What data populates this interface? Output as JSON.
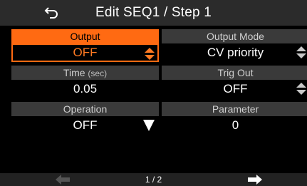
{
  "header": {
    "back_icon": "back-arrow-icon",
    "title": "Edit SEQ1 / Step 1"
  },
  "params": {
    "output": {
      "label": "Output",
      "value": "OFF",
      "control": "updown-icon",
      "selected": true
    },
    "output_mode": {
      "label": "Output Mode",
      "value": "CV priority",
      "control": "updown-icon"
    },
    "time": {
      "label": "Time",
      "unit": "(sec)",
      "value": "0.05"
    },
    "trig_out": {
      "label": "Trig Out",
      "value": "OFF",
      "control": "updown-icon"
    },
    "operation": {
      "label": "Operation",
      "value": "OFF",
      "control": "dropdown-arrow-icon"
    },
    "parameter": {
      "label": "Parameter",
      "value": "0"
    }
  },
  "footer": {
    "prev_icon": "left-arrow-icon",
    "page": "1 / 2",
    "next_icon": "right-arrow-icon"
  },
  "colors": {
    "accent": "#ff6a12",
    "header_bg": "#2b2b2b",
    "label_bg": "#3a3a3a",
    "background": "#000000"
  }
}
